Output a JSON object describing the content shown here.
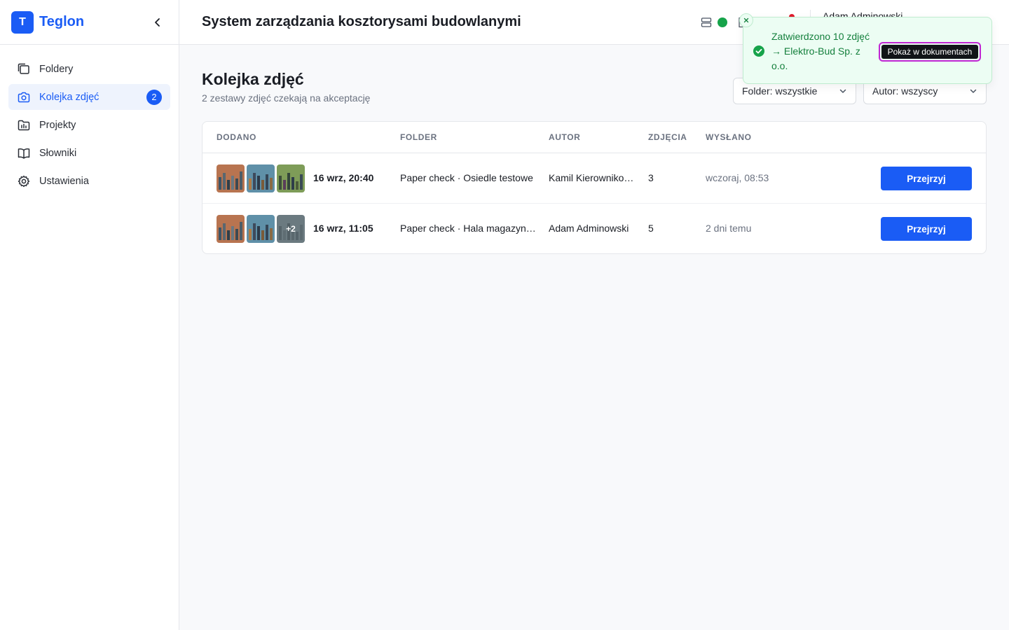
{
  "brand": {
    "logo_letter": "T",
    "name": "Teglon"
  },
  "sidebar": {
    "items": [
      {
        "label": "Foldery",
        "icon": "folders-icon"
      },
      {
        "label": "Kolejka zdjęć",
        "icon": "camera-icon",
        "badge": "2",
        "active": true
      },
      {
        "label": "Projekty",
        "icon": "project-folder-icon"
      },
      {
        "label": "Słowniki",
        "icon": "book-icon"
      },
      {
        "label": "Ustawienia",
        "icon": "gear-icon"
      }
    ]
  },
  "header": {
    "title": "System zarządzania kosztorysami budowlanymi",
    "user_name": "Adam Adminowski",
    "status_color": "#16a34a"
  },
  "main": {
    "title": "Kolejka zdjęć",
    "subtitle": "2 zestawy zdjęć czekają na akceptację",
    "filters": {
      "folder": "Folder: wszystkie",
      "author": "Autor: wszyscy"
    },
    "table": {
      "headers": [
        "DODANO",
        "FOLDER",
        "AUTOR",
        "ZDJĘCIA",
        "WYSŁANO"
      ],
      "rows": [
        {
          "added": "16 wrz, 20:40",
          "folder": "Paper check · Osiedle testowe",
          "author": "Kamil Kierownikowski",
          "count": "3",
          "sent": "wczoraj, 08:53",
          "action": "Przejrzyj",
          "more": ""
        },
        {
          "added": "16 wrz, 11:05",
          "folder": "Paper check · Hala magazynowa",
          "author": "Adam Adminowski",
          "count": "5",
          "sent": "2 dni temu",
          "action": "Przejrzyj",
          "more": "+2"
        }
      ]
    }
  },
  "toast": {
    "message": "Zatwierdzono 10 zdjęć → Elektro-Bud Sp. z o.o.",
    "action": "Pokaż w dokumentach"
  },
  "colors": {
    "accent": "#1a5cf5",
    "success": "#15803d",
    "toast_bg": "#ecfdf3",
    "focus_ring": "#c026d3"
  }
}
